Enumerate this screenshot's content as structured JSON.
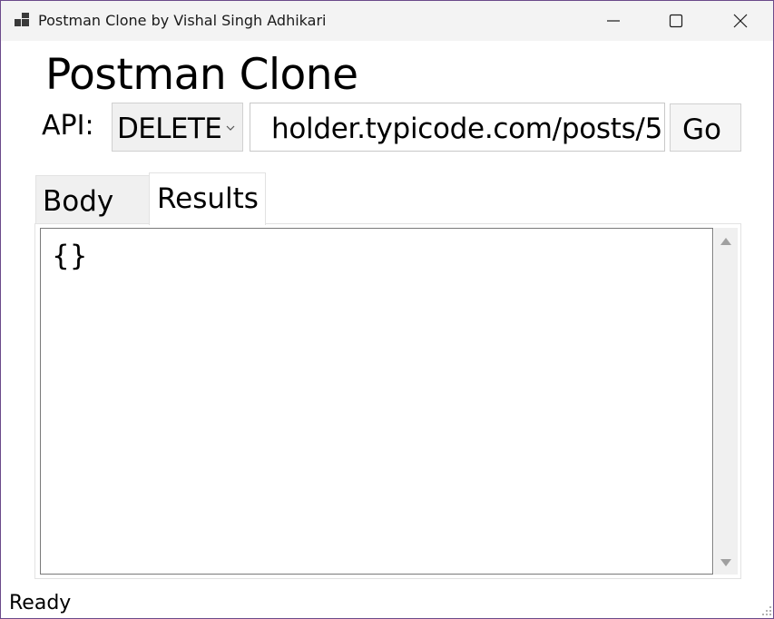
{
  "window": {
    "title": "Postman Clone by Vishal Singh Adhikari",
    "controls": [
      "minimize-icon",
      "maximize-icon",
      "close-icon"
    ]
  },
  "header": {
    "heading": "Postman Clone"
  },
  "request": {
    "api_label": "API:",
    "method": "DELETE",
    "url": "holder.typicode.com/posts/5",
    "go_label": "Go"
  },
  "tabs": [
    {
      "label": "Body",
      "selected": false
    },
    {
      "label": "Results",
      "selected": true
    }
  ],
  "results": {
    "text": "{}"
  },
  "status": {
    "text": "Ready"
  }
}
